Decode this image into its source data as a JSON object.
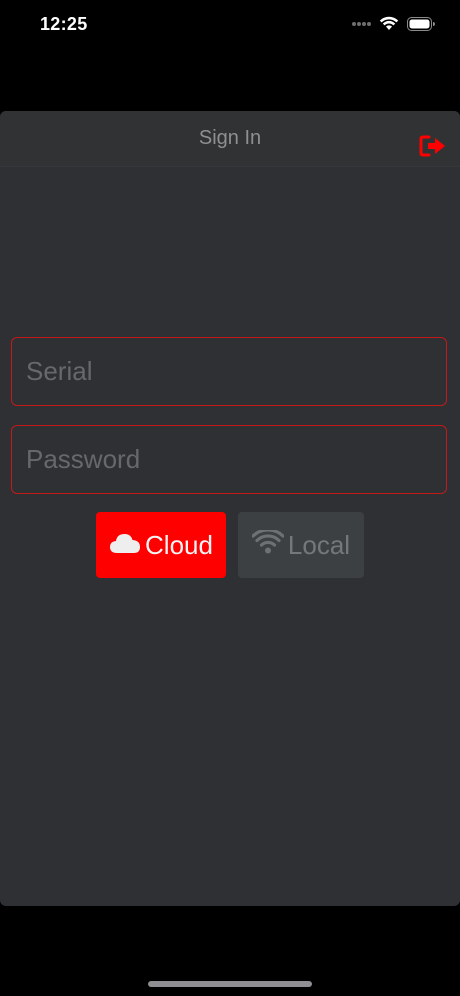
{
  "status_bar": {
    "time": "12:25"
  },
  "header": {
    "title": "Sign In",
    "logout_icon": "sign-out-icon"
  },
  "form": {
    "serial": {
      "placeholder": "Serial",
      "value": ""
    },
    "password": {
      "placeholder": "Password",
      "value": ""
    }
  },
  "modes": {
    "cloud": {
      "label": "Cloud",
      "icon": "cloud-icon",
      "selected": true
    },
    "local": {
      "label": "Local",
      "icon": "wifi-icon",
      "selected": false
    }
  },
  "colors": {
    "accent": "#ff0000",
    "background": "#2e3033",
    "inactive_button": "#3d4043"
  }
}
